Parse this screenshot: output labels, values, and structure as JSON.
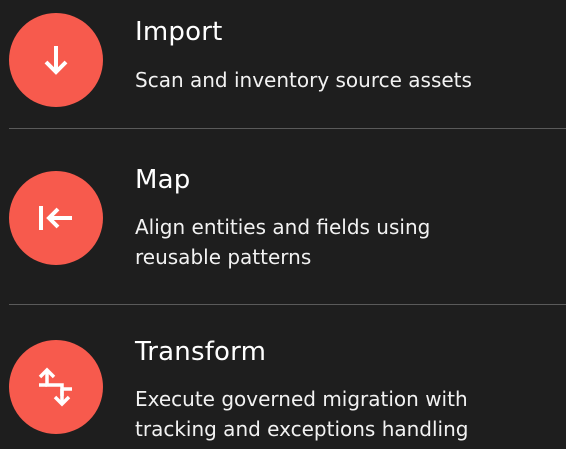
{
  "colors": {
    "background": "#1e1e1e",
    "badge": "#f75a4d",
    "divider": "#5a5a5a",
    "text": "#ffffff"
  },
  "steps": [
    {
      "icon": "arrow-down-icon",
      "title": "Import",
      "description_lines": [
        "Scan and inventory source assets"
      ]
    },
    {
      "icon": "arrow-left-to-bar-icon",
      "title": "Map",
      "description_lines": [
        "Align entities and fields using",
        "reusable patterns"
      ]
    },
    {
      "icon": "transform-arrows-icon",
      "title": "Transform",
      "description_lines": [
        "Execute governed migration with",
        "tracking and exceptions handling"
      ]
    }
  ]
}
